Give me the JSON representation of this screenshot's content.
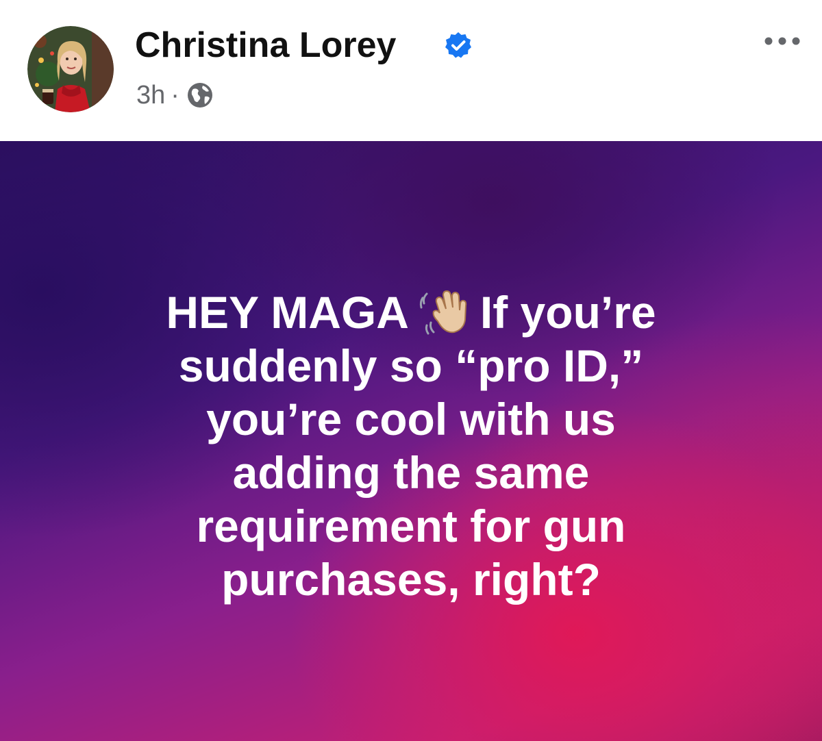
{
  "post": {
    "author": {
      "name": "Christina Lorey",
      "avatar_icon": "profile-photo-avatar",
      "verified_icon": "verified-badge-icon"
    },
    "timestamp": "3h",
    "separator": "·",
    "privacy_icon": "globe-icon",
    "more_icon": "more-options-icon"
  },
  "banner": {
    "lines": [
      "HEY MAGA",
      "If you’re",
      "suddenly so “pro ID,”",
      "you’re cool with us",
      "adding the same",
      "requirement for gun",
      "purchases, right?"
    ],
    "emoji": "waving-hand-icon",
    "colors": {
      "dark": "#2d1060",
      "accent": "#c21f74"
    }
  },
  "colors": {
    "verified": "#1877f2",
    "meta_text": "#65676b",
    "name_text": "#111111"
  }
}
